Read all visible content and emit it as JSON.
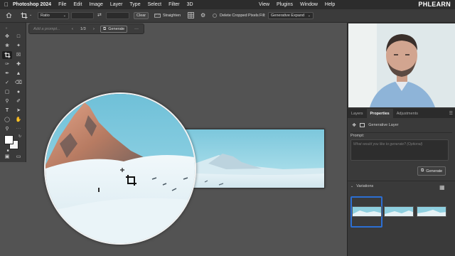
{
  "menubar": {
    "app_name": "Photoshop 2024",
    "items": [
      "File",
      "Edit",
      "Image",
      "Layer",
      "Type",
      "Select",
      "Filter",
      "3D"
    ],
    "right_items": [
      "View",
      "Plugins",
      "Window",
      "Help"
    ],
    "brand": "PHLEARN"
  },
  "options_bar": {
    "ratio_label": "Ratio",
    "clear_label": "Clear",
    "straighten_label": "Straighten",
    "delete_cropped_label": "Delete Cropped Pixels",
    "fill_label": "Fill:",
    "fill_value": "Generative Expand"
  },
  "generate_bar": {
    "placeholder": "Add a prompt...",
    "counter": "1/3",
    "generate_label": "Generate",
    "more": "···"
  },
  "panel": {
    "tabs": [
      "Layers",
      "Properties",
      "Adjustments"
    ],
    "active_tab": "Properties",
    "layer_type": "Generative Layer",
    "prompt_label": "Prompt:",
    "prompt_placeholder": "What would you like to generate? (Optional)",
    "generate_label": "Generate",
    "variations_label": "Variations"
  },
  "colors": {
    "accent": "#2c6fd3",
    "sky": "#8fd0e0",
    "snow": "#eef6fa"
  }
}
